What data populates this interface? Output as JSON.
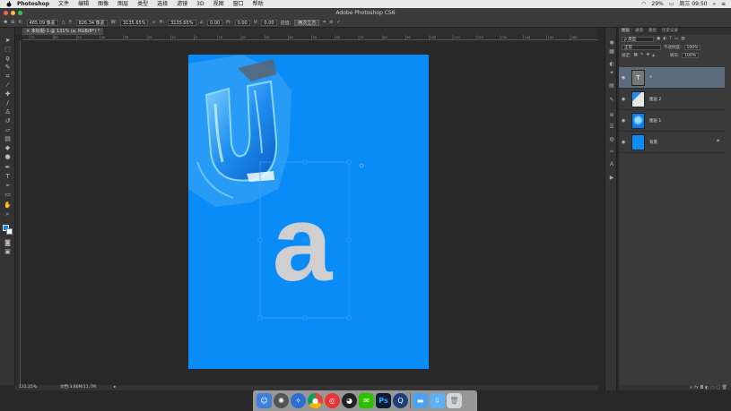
{
  "menubar": {
    "items": [
      "Photoshop",
      "文件",
      "编辑",
      "图像",
      "图层",
      "类型",
      "选择",
      "滤镜",
      "3D",
      "视图",
      "窗口",
      "帮助"
    ],
    "battery": "29%",
    "clock": "周三 09:50"
  },
  "window": {
    "title": "Adobe Photoshop CS6"
  },
  "options_bar": {
    "x_label": "X:",
    "x_value": "465.09 像素",
    "y_label": "Y:",
    "y_value": "826.34 像素",
    "w_label": "W:",
    "w_value": "3135.65%",
    "h_label": "H:",
    "h_value": "3135.65%",
    "angle_value": "0.00",
    "h_skew_label": "H:",
    "h_skew_value": "0.00",
    "v_skew_label": "V:",
    "v_skew_value": "0.00",
    "interp_label": "插值:",
    "interp_value": "两次立方"
  },
  "document": {
    "tab_title": "未标题-1 @ 131% (a, RGB/8*) *",
    "letter": "a",
    "canvas_color": "#0a8cf8"
  },
  "status": {
    "zoom": "131.25%",
    "doc_info": "文档:3.86M/11.7M"
  },
  "ruler_h_labels": [
    "70",
    "60",
    "50",
    "40",
    "30",
    "20",
    "10",
    "0",
    "10",
    "20",
    "30",
    "40",
    "50",
    "60",
    "70",
    "80",
    "90",
    "100",
    "110",
    "120",
    "130",
    "140",
    "150",
    "160"
  ],
  "layers_panel": {
    "tabs": [
      "图层",
      "通道",
      "路径",
      "历史记录"
    ],
    "kind_label": "ρ 类型",
    "blend_mode": "正常",
    "opacity_label": "不透明度:",
    "opacity_value": "100%",
    "lock_label": "锁定:",
    "fill_label": "填充:",
    "fill_value": "100%",
    "layers": [
      {
        "name": "a",
        "type": "text",
        "selected": true
      },
      {
        "name": "图层 2",
        "type": "image"
      },
      {
        "name": "图层 1",
        "type": "image"
      },
      {
        "name": "背景",
        "type": "background"
      }
    ]
  },
  "tools": [
    "move",
    "marquee",
    "lasso",
    "quick-select",
    "crop",
    "eyedropper",
    "healing",
    "brush",
    "stamp",
    "history-brush",
    "eraser",
    "gradient",
    "blur",
    "dodge",
    "pen",
    "type",
    "path-select",
    "shape",
    "hand",
    "zoom"
  ],
  "dock": [
    "finder",
    "launchpad",
    "safari",
    "chrome",
    "weibo",
    "qq",
    "wechat",
    "photoshop",
    "quicktime",
    "folder",
    "downloads",
    "trash"
  ],
  "colors": {
    "accent": "#0a8cf8",
    "letter": "#cfcfcf",
    "selection": "#47a0ff"
  }
}
